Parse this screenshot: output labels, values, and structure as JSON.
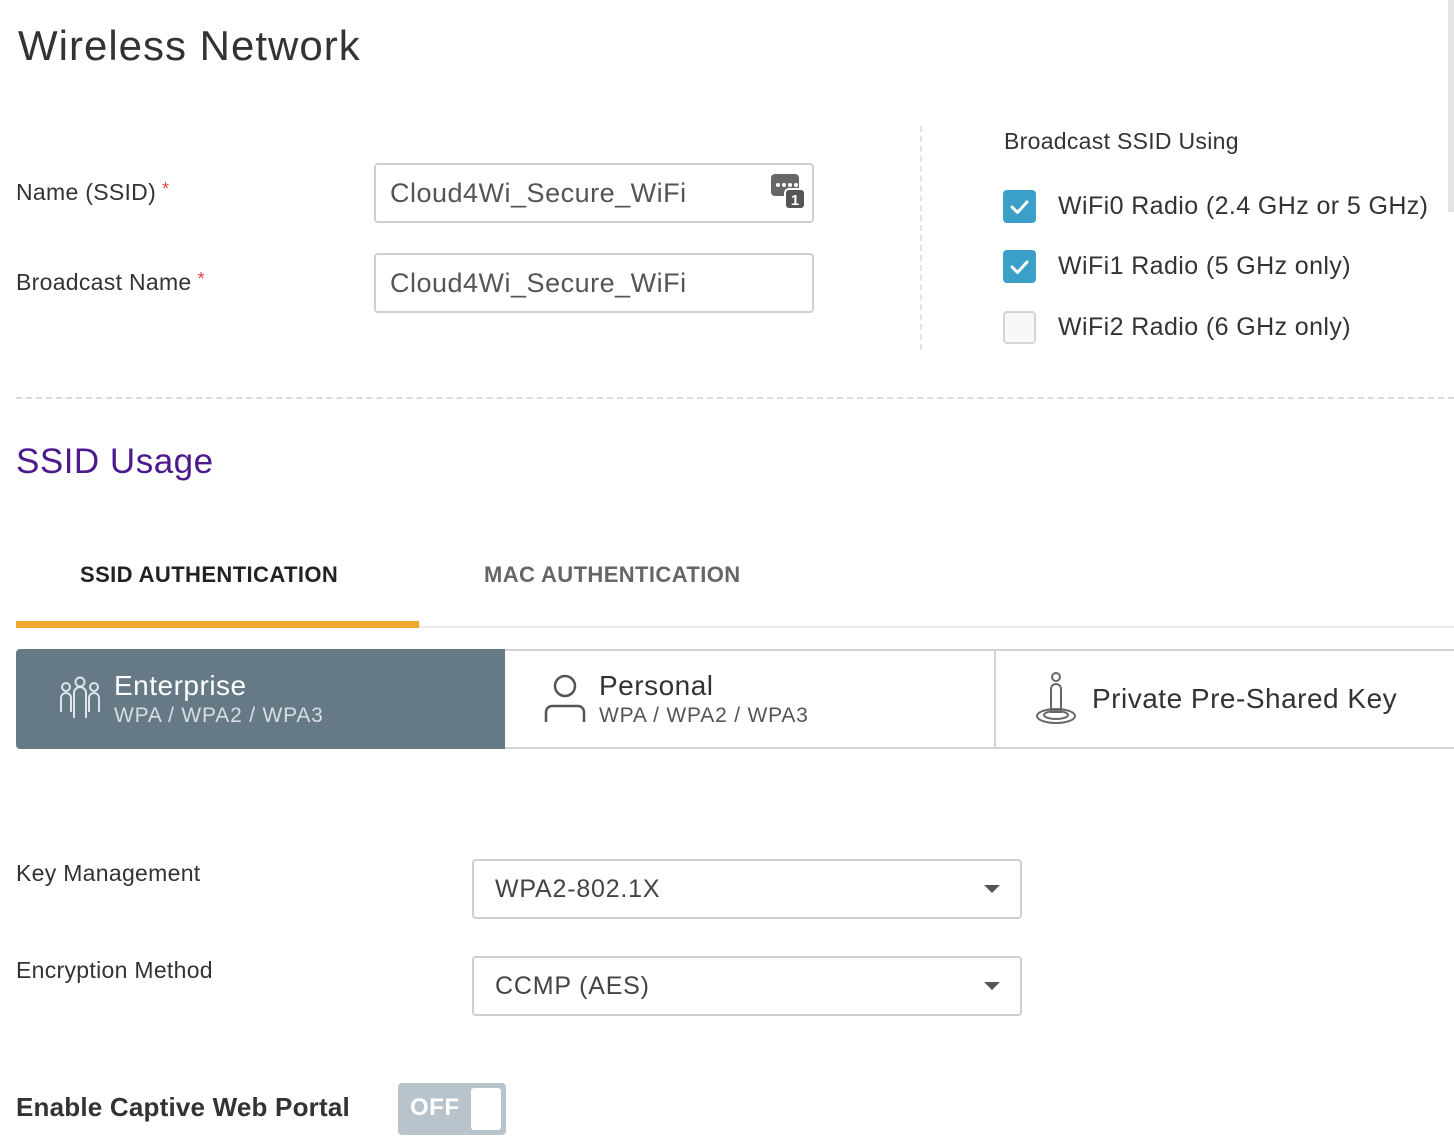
{
  "page": {
    "title": "Wireless Network"
  },
  "form": {
    "ssid_label": "Name (SSID)",
    "ssid_value": "Cloud4Wi_Secure_WiFi",
    "broadcast_label": "Broadcast Name",
    "broadcast_value": "Cloud4Wi_Secure_WiFi",
    "required_mark": "*",
    "badge_count": "1"
  },
  "broadcast_ssid": {
    "title": "Broadcast SSID Using",
    "radios": [
      {
        "label": "WiFi0 Radio (2.4 GHz or 5 GHz)",
        "checked": true
      },
      {
        "label": "WiFi1 Radio (5 GHz only)",
        "checked": true
      },
      {
        "label": "WiFi2 Radio (6 GHz only)",
        "checked": false
      }
    ]
  },
  "ssid_usage": {
    "title": "SSID Usage",
    "tabs": [
      {
        "label": "SSID AUTHENTICATION",
        "active": true
      },
      {
        "label": "MAC AUTHENTICATION",
        "active": false
      }
    ],
    "auth_options": [
      {
        "title": "Enterprise",
        "subtitle": "WPA / WPA2 / WPA3",
        "selected": true,
        "icon": "group-icon"
      },
      {
        "title": "Personal",
        "subtitle": "WPA / WPA2 / WPA3",
        "selected": false,
        "icon": "user-icon"
      },
      {
        "title": "Private Pre-Shared Key",
        "subtitle": "",
        "selected": false,
        "icon": "person-pin-icon"
      }
    ]
  },
  "security": {
    "key_mgmt_label": "Key Management",
    "key_mgmt_value": "WPA2-802.1X",
    "encryption_label": "Encryption Method",
    "encryption_value": "CCMP (AES)"
  },
  "captive_portal": {
    "label": "Enable Captive Web Portal",
    "toggle_text": "OFF",
    "enabled": false
  },
  "colors": {
    "accent_tab": "#f0a92d",
    "section_title": "#4b1a8c",
    "checkbox_checked": "#3aa0c8",
    "card_selected": "#667a86",
    "required": "#e8453c",
    "toggle_off": "#b9c3cb"
  }
}
